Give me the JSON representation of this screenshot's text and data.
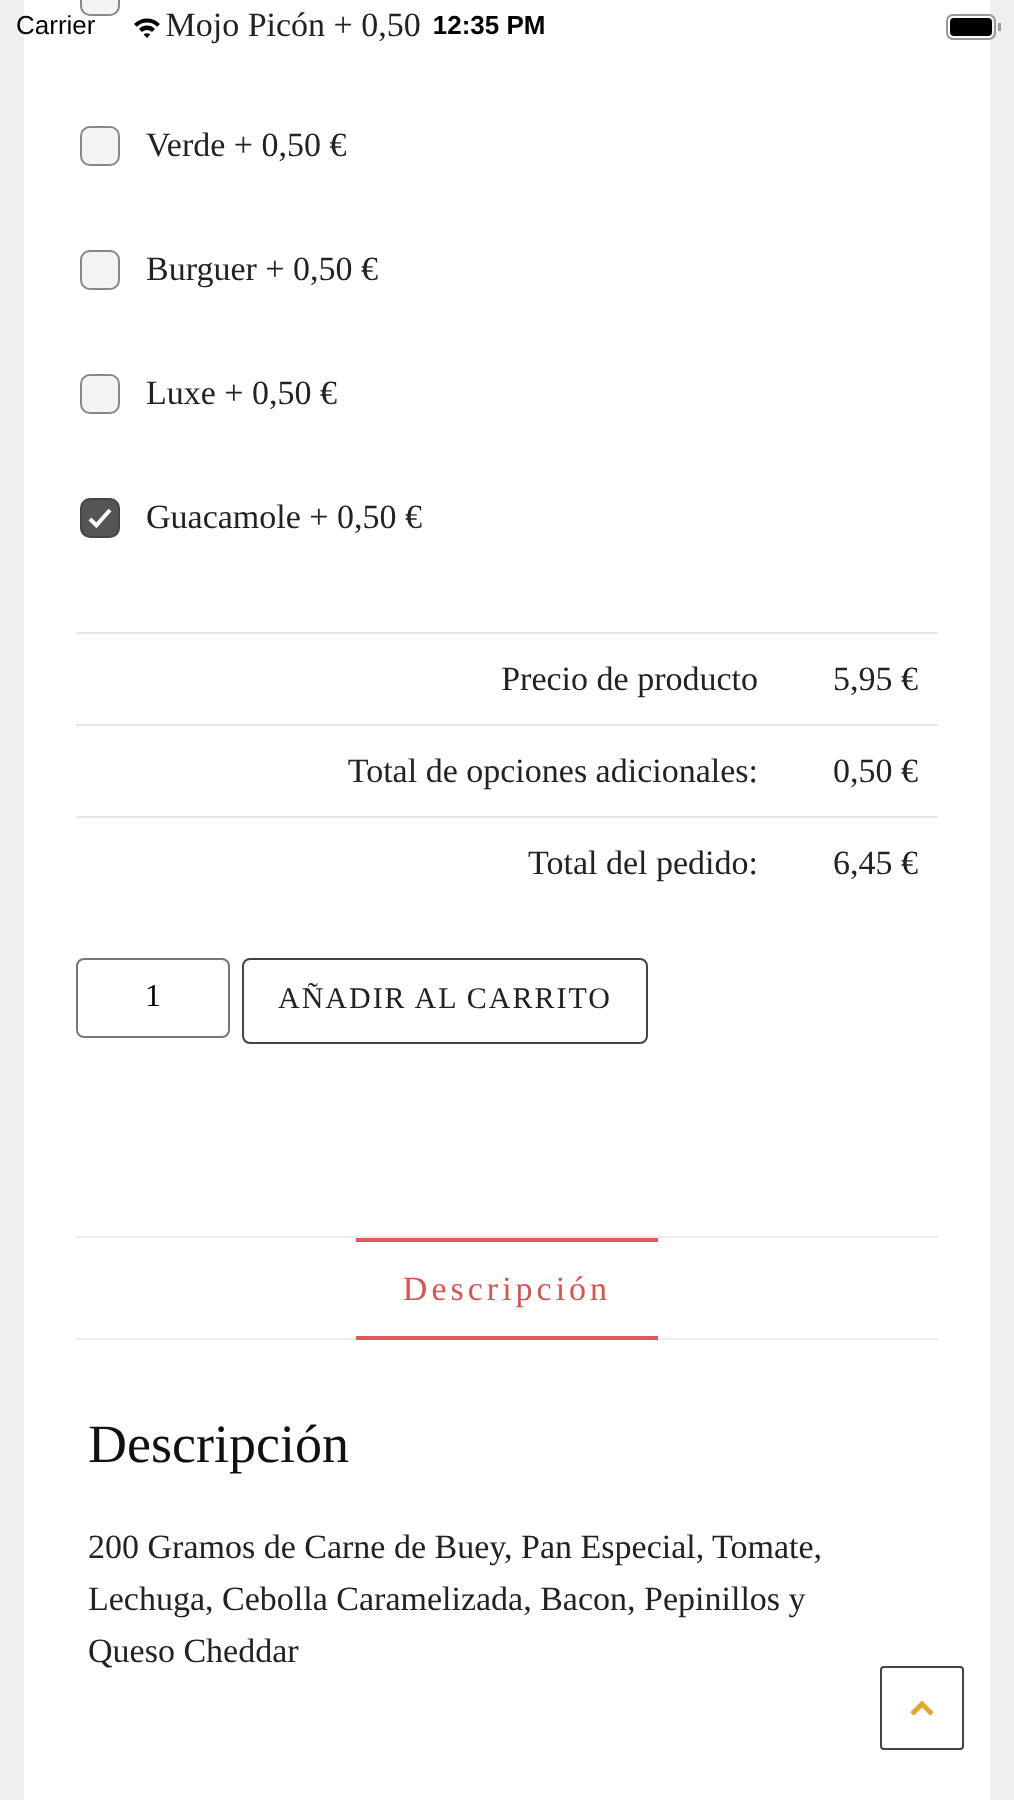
{
  "status_bar": {
    "carrier": "Carrier",
    "time": "12:35 PM"
  },
  "options": [
    {
      "label": "Mojo Picón + 0,50",
      "checked": false
    },
    {
      "label": "Verde + 0,50 €",
      "checked": false
    },
    {
      "label": "Burguer + 0,50 €",
      "checked": false
    },
    {
      "label": "Luxe + 0,50 €",
      "checked": false
    },
    {
      "label": "Guacamole + 0,50 €",
      "checked": true
    }
  ],
  "totals": [
    {
      "label": "Precio de producto",
      "value": "5,95 €"
    },
    {
      "label": "Total de opciones adicionales:",
      "value": "0,50 €"
    },
    {
      "label": "Total del pedido:",
      "value": "6,45 €"
    }
  ],
  "quantity": "1",
  "add_to_cart": "AÑADIR AL CARRITO",
  "tabs": [
    {
      "label": "Descripción",
      "selected": true
    }
  ],
  "description": {
    "title": "Descripción",
    "text": "200 Gramos de Carne de Buey, Pan Especial, Tomate, Lechuga, Cebolla Caramelizada, Bacon, Pepinillos y Queso Cheddar"
  }
}
